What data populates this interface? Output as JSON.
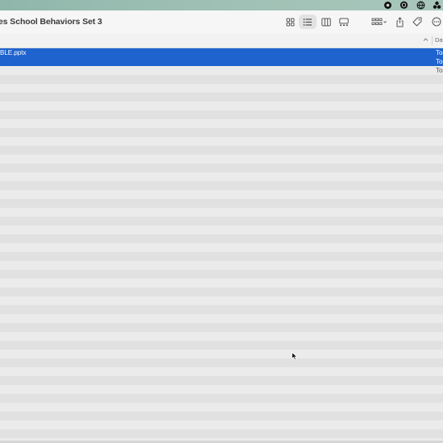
{
  "window": {
    "title": "es School Behaviors Set 3"
  },
  "menubar": {
    "icons": [
      "record-icon",
      "chat-bubble-icon",
      "globe-icon",
      "creative-cloud-icon"
    ]
  },
  "toolbar": {
    "view_buttons": [
      "icon-view",
      "list-view",
      "column-view",
      "gallery-view"
    ],
    "active_view": "list-view",
    "actions": [
      "group-by",
      "share",
      "tags",
      "more"
    ]
  },
  "column_header": {
    "date_label": "Dat"
  },
  "files": [
    {
      "name": "BLE.pptx",
      "date": "Tod",
      "selected": true
    },
    {
      "name": "",
      "date": "Tod",
      "selected": true
    },
    {
      "name": "",
      "date": "Tod",
      "selected": false
    }
  ],
  "colors": {
    "selection": "#1f63cf",
    "row_even": "#ebebeb",
    "row_odd": "#e1e1e1"
  }
}
